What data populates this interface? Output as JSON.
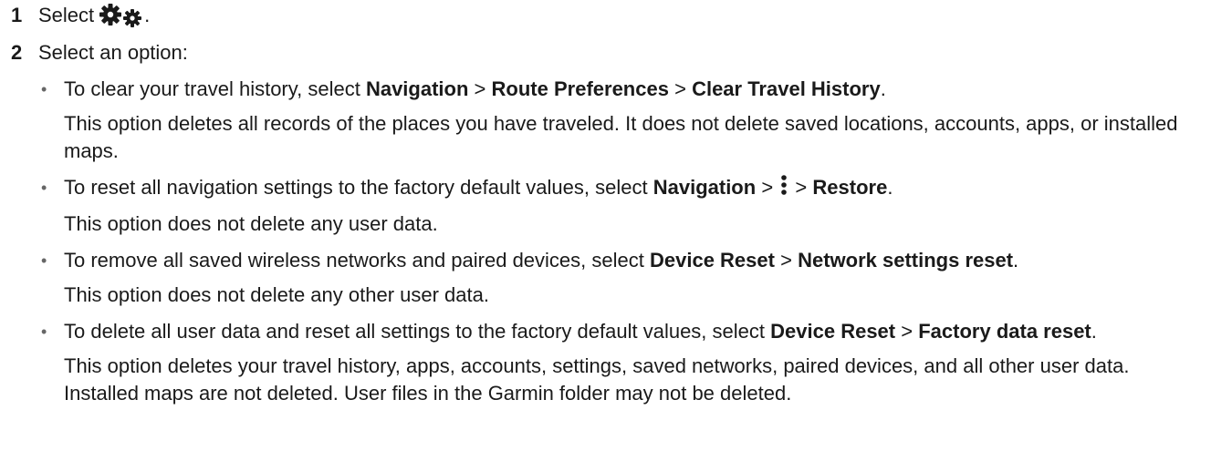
{
  "steps": [
    {
      "num": "1",
      "text": "Select",
      "icon": "settings-gears-icon",
      "suffix": "."
    },
    {
      "num": "2",
      "text": "Select an option:"
    }
  ],
  "options": [
    {
      "intro": "To clear your travel history, select",
      "path": [
        "Navigation",
        "Route Preferences",
        "Clear Travel History"
      ],
      "end": ".",
      "desc": "This option deletes all records of the places you have traveled. It does not delete saved locations, accounts, apps, or installed maps."
    },
    {
      "intro": "To reset all navigation settings to the factory default values, select",
      "path_1": "Navigation",
      "menu_icon": "vertical-menu-icon",
      "path_2": "Restore",
      "end": ".",
      "desc": "This option does not delete any user data."
    },
    {
      "intro": "To remove all saved wireless networks and paired devices, select",
      "path": [
        "Device Reset",
        "Network settings reset"
      ],
      "end": ".",
      "desc": "This option does not delete any other user data."
    },
    {
      "intro": "To delete all user data and reset all settings to the factory default values, select",
      "path": [
        "Device Reset",
        "Factory data reset"
      ],
      "end": ".",
      "desc": "This option deletes your travel history, apps, accounts, settings, saved networks, paired devices, and all other user data. Installed maps are not deleted. User files in the Garmin folder may not be deleted."
    }
  ],
  "separator": ">",
  "bullet": "•"
}
